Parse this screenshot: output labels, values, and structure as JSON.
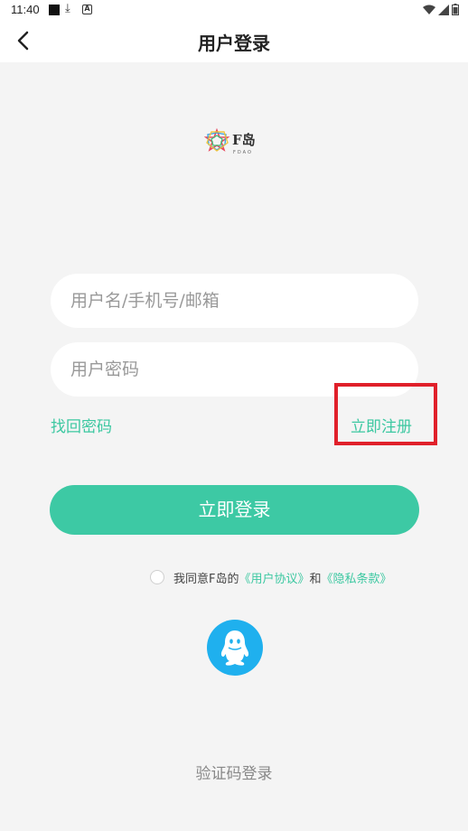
{
  "status_bar": {
    "time": "11:40"
  },
  "header": {
    "title": "用户登录"
  },
  "logo": {
    "text": "F岛",
    "subtext": "FDAO"
  },
  "form": {
    "username_placeholder": "用户名/手机号/邮箱",
    "password_placeholder": "用户密码",
    "forgot_label": "找回密码",
    "register_label": "立即注册",
    "login_label": "立即登录"
  },
  "agreement": {
    "prefix": "我同意F岛的",
    "user_agreement": "《用户协议》",
    "conjunction": "和",
    "privacy": "《隐私条款》",
    "checked": false
  },
  "social": {
    "qq_icon": "qq-icon"
  },
  "footer": {
    "code_login_label": "验证码登录"
  },
  "colors": {
    "accent": "#3dc9a4",
    "highlight": "#e0202a",
    "qq": "#1fb0ee"
  }
}
